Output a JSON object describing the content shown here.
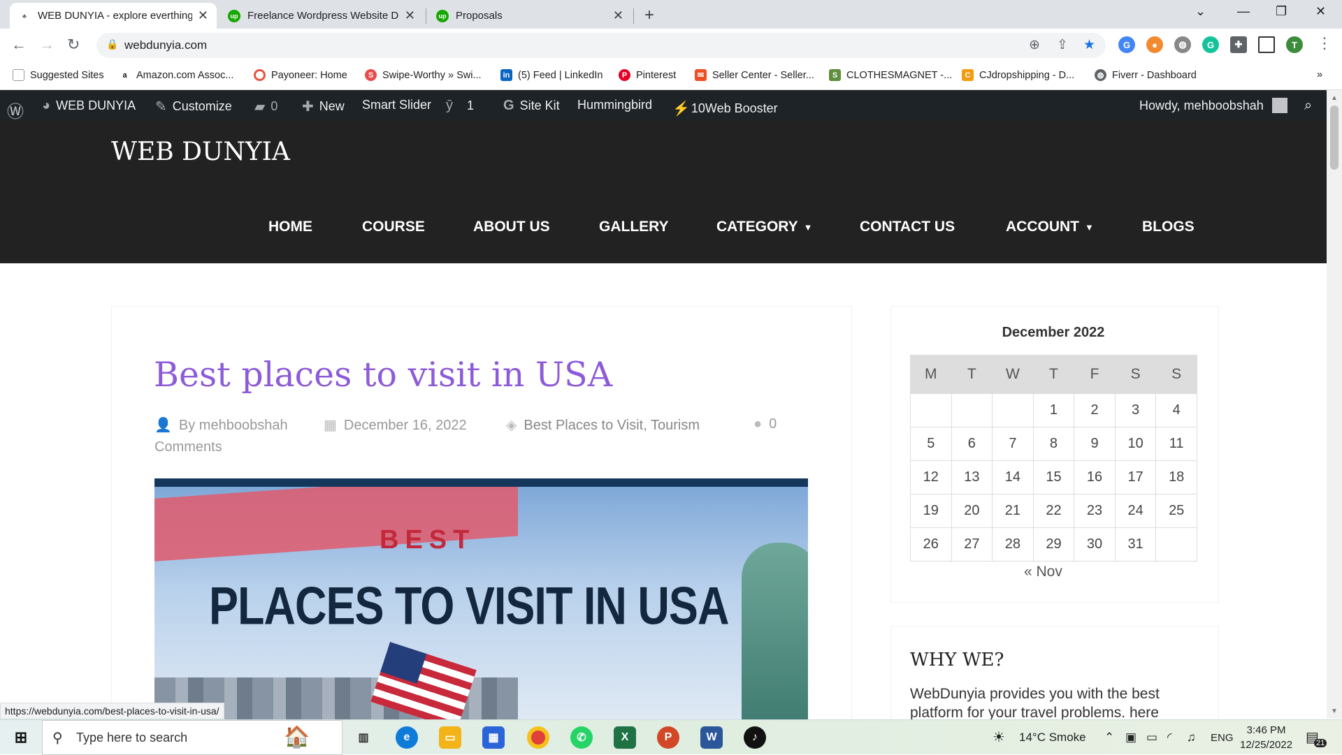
{
  "browser": {
    "tabs": [
      {
        "title": "WEB DUNYIA - explore everthing",
        "close": "✕"
      },
      {
        "title": "Freelance Wordpress Website De",
        "close": "✕"
      },
      {
        "title": "Proposals",
        "close": "✕"
      }
    ],
    "new_tab": "+",
    "url": "webdunyia.com",
    "profile_initial": "T",
    "bookmarks": [
      "Suggested Sites",
      "Amazon.com Assoc...",
      "Payoneer: Home",
      "Swipe-Worthy » Swi...",
      "(5) Feed | LinkedIn",
      "Pinterest",
      "Seller Center - Seller...",
      "CLOTHESMAGNET -...",
      "CJdropshipping - D...",
      "Fiverr - Dashboard"
    ],
    "bookmarks_more": "»"
  },
  "wp_admin_bar": {
    "site_name": "WEB DUNYIA",
    "customize": "Customize",
    "comments_count": "0",
    "new": "New",
    "smart_slider": "Smart Slider",
    "yoast_count": "1",
    "site_kit": "Site Kit",
    "hummingbird": "Hummingbird",
    "booster": "10Web Booster",
    "howdy": "Howdy, mehboobshah"
  },
  "site": {
    "title": "WEB DUNYIA",
    "menu": [
      "HOME",
      "COURSE",
      "ABOUT US",
      "GALLERY",
      "CATEGORY",
      "CONTACT US",
      "ACCOUNT",
      "BLOGS"
    ],
    "caret": "▼"
  },
  "post": {
    "title": "Best places to visit in USA",
    "author": "By mehboobshah",
    "date": "December 16, 2022",
    "categories": "Best Places to Visit, Tourism",
    "comments_count": "0",
    "comments_word": "Comments",
    "image_line1": "BEST",
    "image_line2": "PLACES TO VISIT IN USA"
  },
  "calendar": {
    "title": "December 2022",
    "weekdays": [
      "M",
      "T",
      "W",
      "T",
      "F",
      "S",
      "S"
    ],
    "weeks": [
      [
        "",
        "",
        "",
        "1",
        "2",
        "3",
        "4"
      ],
      [
        "5",
        "6",
        "7",
        "8",
        "9",
        "10",
        "11"
      ],
      [
        "12",
        "13",
        "14",
        "15",
        "16",
        "17",
        "18"
      ],
      [
        "19",
        "20",
        "21",
        "22",
        "23",
        "24",
        "25"
      ],
      [
        "26",
        "27",
        "28",
        "29",
        "30",
        "31",
        ""
      ]
    ],
    "prev": "« Nov"
  },
  "why": {
    "title": "WHY WE?",
    "text": "WebDunyia provides you with the best platform for your travel problems. here"
  },
  "status_url": "https://webdunyia.com/best-places-to-visit-in-usa/",
  "taskbar": {
    "search_placeholder": "Type here to search",
    "weather": "14°C  Smoke",
    "lang": "ENG",
    "time": "3:46 PM",
    "date": "12/25/2022",
    "notifications": "21"
  },
  "colors": {
    "accent": "#8d5bd9",
    "wp_bar": "#1d2327",
    "header": "#222222"
  }
}
